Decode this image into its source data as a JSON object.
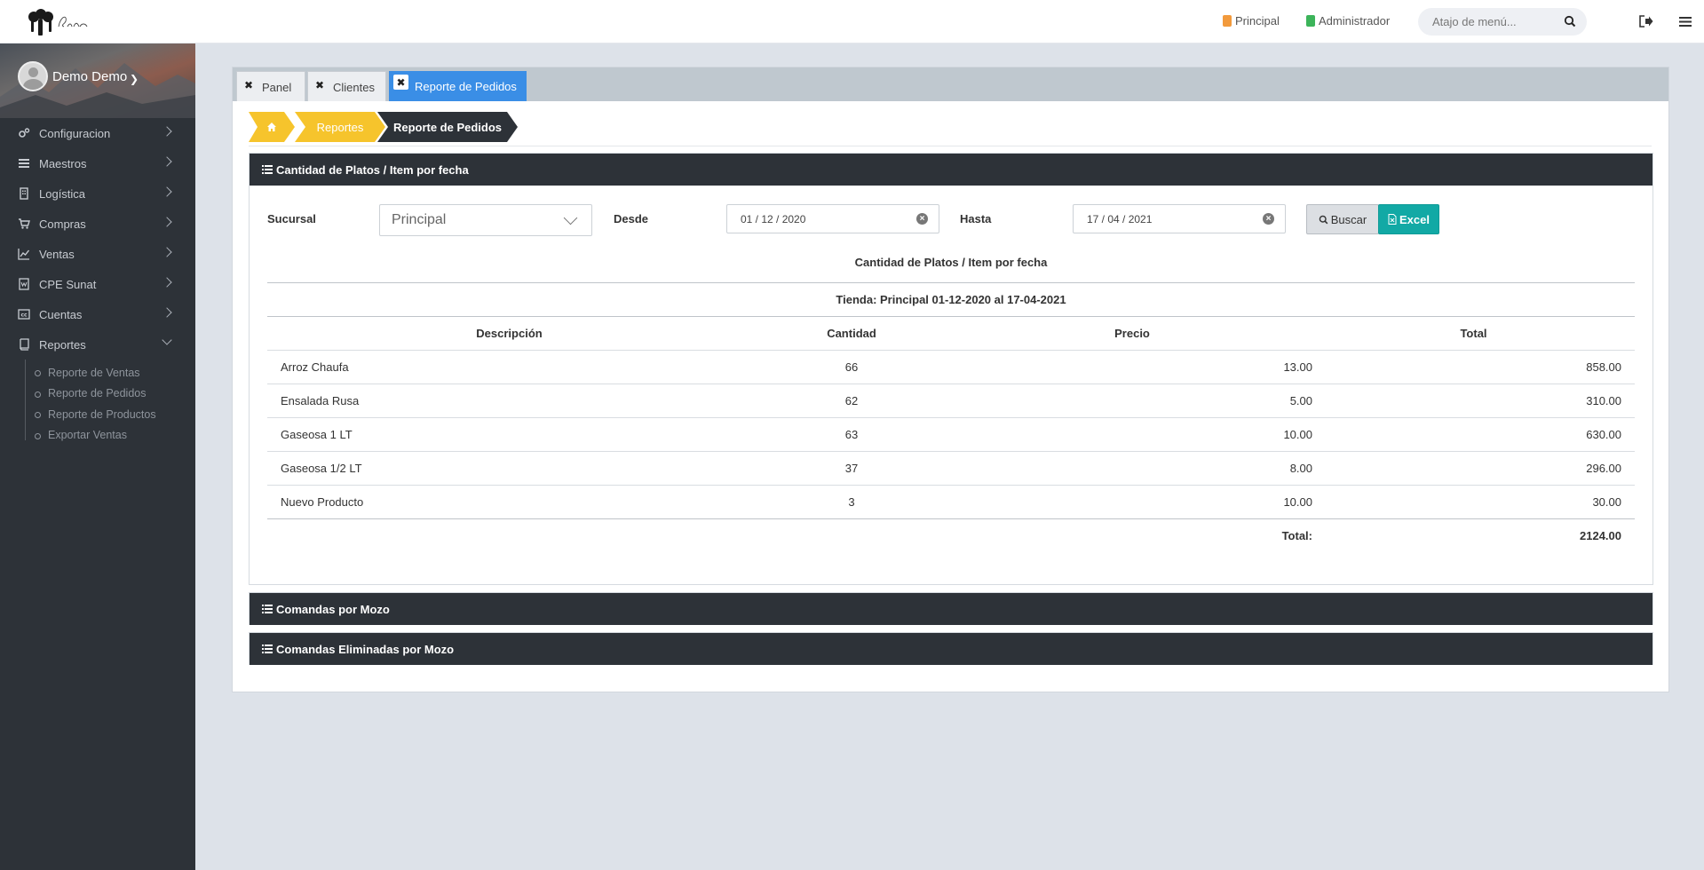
{
  "topbar": {
    "links": [
      "Principal",
      "Administrador"
    ],
    "search_placeholder": "Atajo de menú..."
  },
  "sidebar": {
    "user_name": "Demo Demo",
    "items": [
      {
        "label": "Configuracion",
        "icon": "gears-icon"
      },
      {
        "label": "Maestros",
        "icon": "list-icon"
      },
      {
        "label": "Logística",
        "icon": "building-icon"
      },
      {
        "label": "Compras",
        "icon": "cart-icon"
      },
      {
        "label": "Ventas",
        "icon": "line-chart-icon"
      },
      {
        "label": "CPE Sunat",
        "icon": "document-icon"
      },
      {
        "label": "Cuentas",
        "icon": "cc-icon"
      },
      {
        "label": "Reportes",
        "icon": "book-icon"
      }
    ],
    "reportes_sub": [
      "Reporte de Ventas",
      "Reporte de Pedidos",
      "Reporte de Productos",
      "Exportar Ventas"
    ]
  },
  "tabs": [
    "Panel",
    "Clientes",
    "Reporte de Pedidos"
  ],
  "breadcrumb": {
    "section": "Reportes",
    "current": "Reporte de Pedidos"
  },
  "panel1": {
    "title": "Cantidad de Platos / Item por fecha",
    "sucursal_label": "Sucursal",
    "sucursal_value": "Principal",
    "desde_label": "Desde",
    "desde_value": "01 / 12 / 2020",
    "hasta_label": "Hasta",
    "hasta_value": "17 / 04 / 2021",
    "buscar_label": "Buscar",
    "excel_label": "Excel",
    "report_title": "Cantidad de Platos / Item por fecha",
    "store_line": "Tienda: Principal 01-12-2020 al 17-04-2021",
    "columns": [
      "Descripción",
      "Cantidad",
      "Precio",
      "Total"
    ],
    "rows": [
      [
        "Arroz Chaufa",
        "66",
        "13.00",
        "858.00"
      ],
      [
        "Ensalada Rusa",
        "62",
        "5.00",
        "310.00"
      ],
      [
        "Gaseosa 1 LT",
        "63",
        "10.00",
        "630.00"
      ],
      [
        "Gaseosa 1/2 LT",
        "37",
        "8.00",
        "296.00"
      ],
      [
        "Nuevo Producto",
        "3",
        "10.00",
        "30.00"
      ]
    ],
    "total_label": "Total:",
    "total_value": "2124.00"
  },
  "panel2": {
    "title": "Comandas por Mozo"
  },
  "panel3": {
    "title": "Comandas Eliminadas por Mozo"
  },
  "colors": {
    "sidebar": "#2d3238",
    "active_tab": "#3a8ee6",
    "breadcrumb_yellow": "#f6c42c",
    "excel": "#12a9a5"
  }
}
